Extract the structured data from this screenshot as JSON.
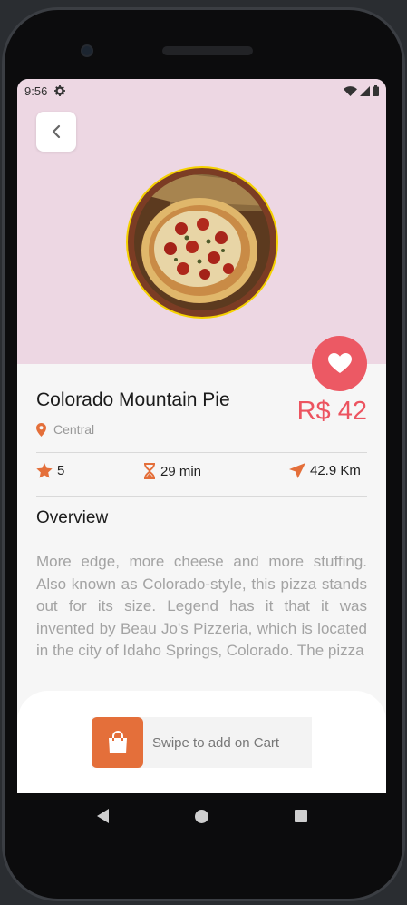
{
  "status_bar": {
    "time": "9:56"
  },
  "product": {
    "name": "Colorado Mountain Pie",
    "price": "R$ 42",
    "location": "Central"
  },
  "stats": {
    "rating": "5",
    "time": "29 min",
    "distance": "42.9 Km"
  },
  "overview": {
    "heading": "Overview",
    "text": "More edge, more cheese and more stuffing. Also known as Colorado-style, this pizza stands out for its size. Legend has it that it was invented by Beau Jo's Pizzeria, which is located in the city of Idaho Springs, Colorado. The pizza"
  },
  "cart": {
    "swipe_label": "Swipe to add on Cart"
  },
  "colors": {
    "hero_bg": "#edd7e3",
    "accent_red": "#ec5964",
    "accent_orange": "#e46f3a"
  },
  "icons": {
    "back": "chevron-left-icon",
    "favorite": "heart-icon",
    "location": "location-pin-icon",
    "rating": "star-icon",
    "time": "hourglass-icon",
    "distance": "paper-plane-icon",
    "cart": "shopping-bag-icon"
  }
}
